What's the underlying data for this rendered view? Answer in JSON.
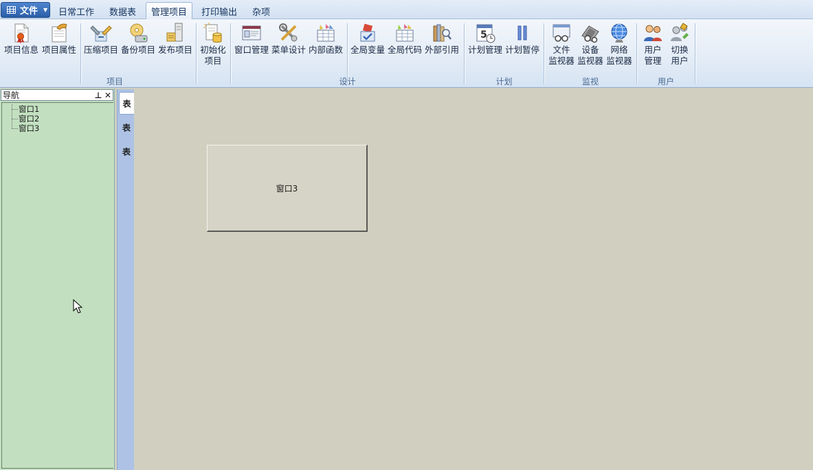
{
  "file_menu": {
    "label": "文件"
  },
  "tabs": [
    {
      "label": "日常工作",
      "active": false
    },
    {
      "label": "数据表",
      "active": false
    },
    {
      "label": "管理项目",
      "active": true
    },
    {
      "label": "打印输出",
      "active": false
    },
    {
      "label": "杂项",
      "active": false
    }
  ],
  "ribbon": {
    "groups": {
      "project": "项目",
      "design": "设计",
      "plan": "计划",
      "monitor": "监视",
      "user": "用户"
    },
    "buttons": {
      "project_info": "项目信息",
      "project_props": "项目属性",
      "compress": "压缩项目",
      "backup": "备份项目",
      "publish": "发布项目",
      "init_1": "初始化",
      "init_2": "项目",
      "window_mgmt": "窗口管理",
      "menu_design": "菜单设计",
      "internal_func": "内部函数",
      "global_var": "全局变量",
      "global_code": "全局代码",
      "external_ref": "外部引用",
      "plan_mgmt": "计划管理",
      "plan_pause": "计划暂停",
      "file_mon_1": "文件",
      "file_mon_2": "监视器",
      "dev_mon_1": "设备",
      "dev_mon_2": "监视器",
      "net_mon_1": "网络",
      "net_mon_2": "监视器",
      "user_mgmt_1": "用户",
      "user_mgmt_2": "管理",
      "switch_user_1": "切换",
      "switch_user_2": "用户"
    }
  },
  "nav": {
    "title": "导航",
    "items": [
      "窗口1",
      "窗口2",
      "窗口3"
    ]
  },
  "vertical_tabs": [
    "表",
    "表",
    "表"
  ],
  "workspace": {
    "window_title": "窗口3"
  }
}
